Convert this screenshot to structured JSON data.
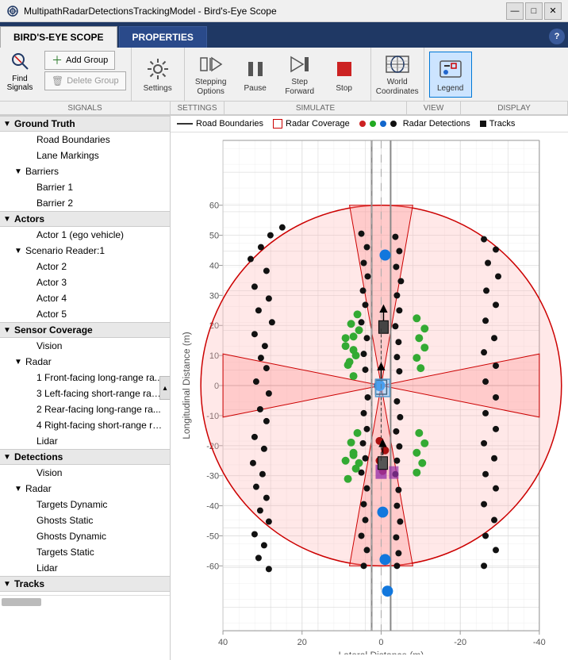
{
  "window": {
    "title": "MultipathRadarDetectionsTrackingModel - Bird's-Eye Scope",
    "icon": "radar-icon"
  },
  "tabs": [
    {
      "id": "birds-eye",
      "label": "BIRD'S-EYE SCOPE",
      "active": true
    },
    {
      "id": "properties",
      "label": "PROPERTIES",
      "active": false
    }
  ],
  "help_label": "?",
  "toolbar": {
    "signals_group_label": "SIGNALS",
    "settings_group_label": "SETTINGS",
    "simulate_group_label": "SIMULATE",
    "view_group_label": "VIEW",
    "display_group_label": "DISPLAY",
    "find_signals_label": "Find\nSignals",
    "add_group_label": "Add Group",
    "delete_group_label": "Delete Group",
    "settings_label": "Settings",
    "stepping_label": "Stepping\nOptions",
    "pause_label": "Pause",
    "step_forward_label": "Step\nForward",
    "stop_label": "Stop",
    "world_coordinates_label": "World\nCoordinates",
    "legend_label": "Legend"
  },
  "sidebar": {
    "items": [
      {
        "id": "ground-truth",
        "label": "Ground Truth",
        "level": 0,
        "toggle": "▼",
        "section": true
      },
      {
        "id": "road-boundaries",
        "label": "Road Boundaries",
        "level": 2,
        "toggle": ""
      },
      {
        "id": "lane-markings",
        "label": "Lane Markings",
        "level": 2,
        "toggle": ""
      },
      {
        "id": "barriers",
        "label": "Barriers",
        "level": 1,
        "toggle": "▼"
      },
      {
        "id": "barrier-1",
        "label": "Barrier 1",
        "level": 2,
        "toggle": ""
      },
      {
        "id": "barrier-2",
        "label": "Barrier 2",
        "level": 2,
        "toggle": ""
      },
      {
        "id": "actors",
        "label": "Actors",
        "level": 0,
        "toggle": "▼",
        "section": true
      },
      {
        "id": "actor-1",
        "label": "Actor 1 (ego vehicle)",
        "level": 2,
        "toggle": ""
      },
      {
        "id": "scenario-reader",
        "label": "Scenario Reader:1",
        "level": 1,
        "toggle": "▼"
      },
      {
        "id": "actor-2",
        "label": "Actor 2",
        "level": 2,
        "toggle": ""
      },
      {
        "id": "actor-3",
        "label": "Actor 3",
        "level": 2,
        "toggle": ""
      },
      {
        "id": "actor-4",
        "label": "Actor 4",
        "level": 2,
        "toggle": ""
      },
      {
        "id": "actor-5",
        "label": "Actor 5",
        "level": 2,
        "toggle": ""
      },
      {
        "id": "sensor-coverage",
        "label": "Sensor Coverage",
        "level": 0,
        "toggle": "▼",
        "section": true
      },
      {
        "id": "vision-sc",
        "label": "Vision",
        "level": 2,
        "toggle": ""
      },
      {
        "id": "radar-sc",
        "label": "Radar",
        "level": 1,
        "toggle": "▼"
      },
      {
        "id": "radar-1",
        "label": "1 Front-facing long-range ra...",
        "level": 2,
        "toggle": ""
      },
      {
        "id": "radar-3",
        "label": "3 Left-facing short-range rac...",
        "level": 2,
        "toggle": ""
      },
      {
        "id": "radar-2",
        "label": "2 Rear-facing long-range ra...",
        "level": 2,
        "toggle": ""
      },
      {
        "id": "radar-4",
        "label": "4 Right-facing short-range ra...",
        "level": 2,
        "toggle": ""
      },
      {
        "id": "lidar-sc",
        "label": "Lidar",
        "level": 2,
        "toggle": ""
      },
      {
        "id": "detections",
        "label": "Detections",
        "level": 0,
        "toggle": "▼",
        "section": true
      },
      {
        "id": "vision-det",
        "label": "Vision",
        "level": 2,
        "toggle": ""
      },
      {
        "id": "radar-det",
        "label": "Radar",
        "level": 1,
        "toggle": "▼"
      },
      {
        "id": "targets-dynamic",
        "label": "Targets Dynamic",
        "level": 2,
        "toggle": ""
      },
      {
        "id": "ghosts-static",
        "label": "Ghosts Static",
        "level": 2,
        "toggle": ""
      },
      {
        "id": "ghosts-dynamic",
        "label": "Ghosts Dynamic",
        "level": 2,
        "toggle": ""
      },
      {
        "id": "targets-static",
        "label": "Targets Static",
        "level": 2,
        "toggle": ""
      },
      {
        "id": "lidar-det",
        "label": "Lidar",
        "level": 2,
        "toggle": ""
      },
      {
        "id": "tracks",
        "label": "Tracks",
        "level": 0,
        "toggle": "▼",
        "section": true
      }
    ]
  },
  "chart": {
    "legend_items": [
      {
        "id": "road-boundaries",
        "type": "line",
        "color": "#333",
        "label": "Road Boundaries"
      },
      {
        "id": "radar-coverage",
        "type": "box",
        "color": "#cc0000",
        "label": "Radar Coverage"
      },
      {
        "id": "det-red",
        "type": "dot",
        "color": "#cc2222",
        "label": ""
      },
      {
        "id": "det-green",
        "type": "dot",
        "color": "#22aa22",
        "label": ""
      },
      {
        "id": "det-blue",
        "type": "dot",
        "color": "#2266cc",
        "label": ""
      },
      {
        "id": "det-black",
        "type": "dot",
        "color": "#111",
        "label": "Radar Detections"
      },
      {
        "id": "tracks",
        "type": "sq",
        "color": "#111",
        "label": "Tracks"
      }
    ],
    "x_axis_label": "Lateral Distance (m)",
    "y_axis_label": "Longitudinal Distance (m)",
    "x_ticks": [
      "-40",
      "-20",
      "0",
      "20",
      "40"
    ],
    "y_ticks": [
      "-60",
      "-50",
      "-40",
      "-30",
      "-20",
      "-10",
      "0",
      "10",
      "20",
      "30",
      "40",
      "50",
      "60"
    ],
    "x_range": {
      "min": -40,
      "max": 40
    },
    "y_range": {
      "min": -65,
      "max": 65
    }
  }
}
